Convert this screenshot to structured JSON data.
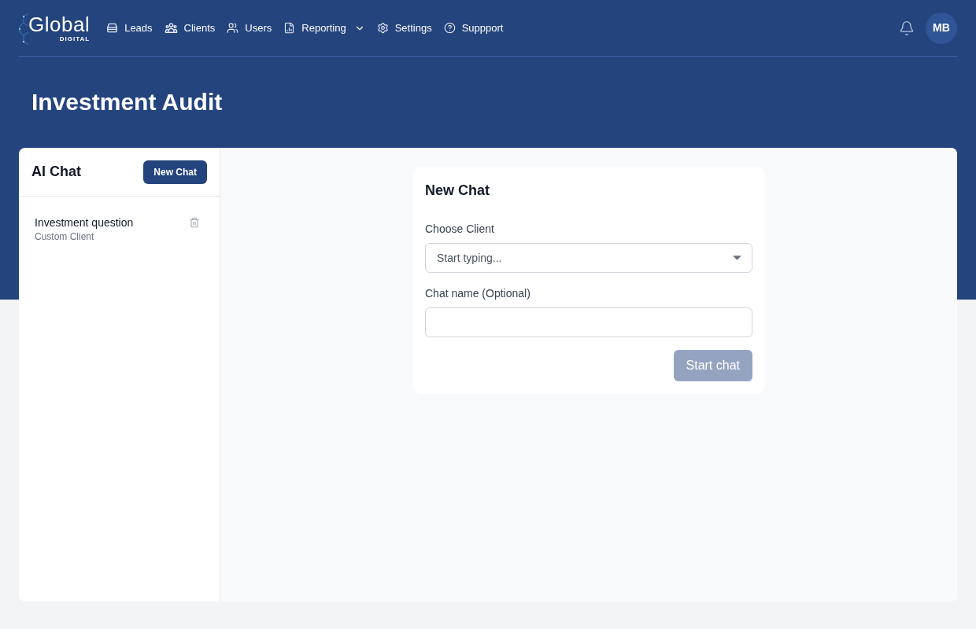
{
  "logo": {
    "wordmark": "Global",
    "subtext": "DIGITAL"
  },
  "nav": [
    {
      "label": "Leads",
      "dropdown": false
    },
    {
      "label": "Clients",
      "dropdown": false
    },
    {
      "label": "Users",
      "dropdown": false
    },
    {
      "label": "Reporting",
      "dropdown": true
    },
    {
      "label": "Settings",
      "dropdown": false
    },
    {
      "label": "Suppport",
      "dropdown": false
    }
  ],
  "user": {
    "initials": "MB"
  },
  "page_title": "Investment Audit",
  "sidebar": {
    "title": "AI Chat",
    "new_button": "New Chat",
    "chats": [
      {
        "name": "Investment question",
        "client": "Custom Client"
      }
    ]
  },
  "new_chat_form": {
    "title": "New Chat",
    "fields": [
      {
        "kind": "select",
        "label": "Choose Client",
        "placeholder": "Start typing..."
      },
      {
        "kind": "text",
        "label": "Chat name (Optional)"
      }
    ],
    "submit": {
      "label": "Start chat",
      "disabled": true
    }
  }
}
